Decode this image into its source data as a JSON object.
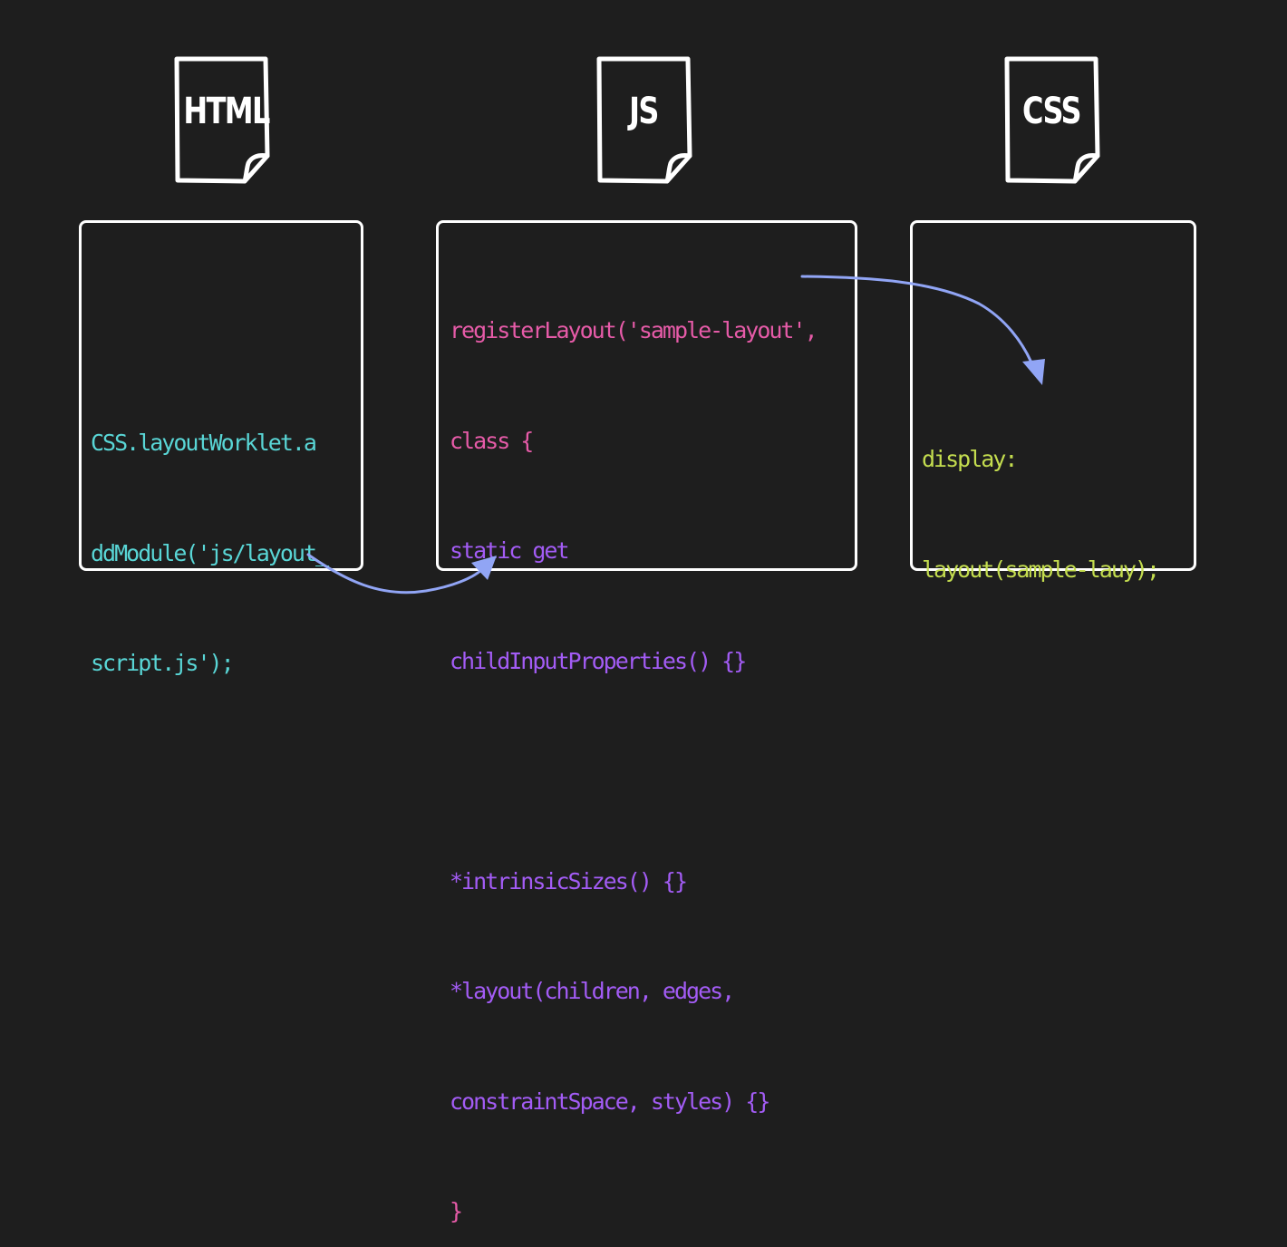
{
  "files": {
    "html": {
      "label": "HTML"
    },
    "js": {
      "label": "JS"
    },
    "css": {
      "label": "CSS"
    }
  },
  "html_box": {
    "lines": [
      "CSS.layoutWorklet.a",
      "ddModule('js/layout_",
      "script.js');"
    ]
  },
  "js_box": {
    "line1": "registerLayout('sample-layout',",
    "line2": "class {",
    "line3": "static get",
    "line4": "childInputProperties() {}",
    "line5": "*intrinsicSizes() {}",
    "line6": "*layout(children, edges,",
    "line7": "constraintSpace, styles) {}",
    "line8": "}"
  },
  "css_box": {
    "lines": [
      "display:",
      "layout(sample-lauy);"
    ]
  },
  "colors": {
    "background": "#1e1e1e",
    "outline": "#ffffff",
    "html_code": "#59d6d6",
    "js_keyword": "#e65ba8",
    "js_body": "#a35cf5",
    "css_code": "#c4dd4f",
    "arrow": "#91a5f5"
  }
}
